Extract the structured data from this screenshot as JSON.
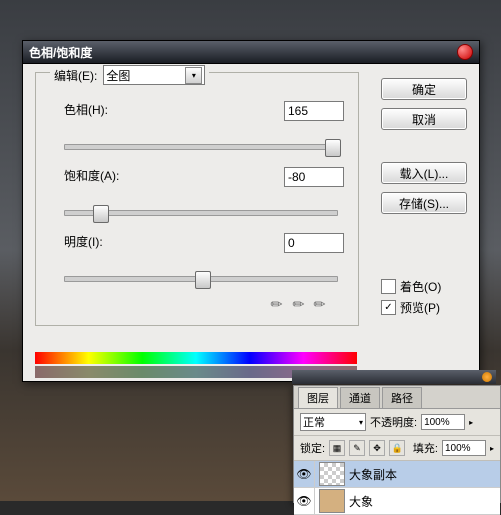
{
  "dialog": {
    "title": "色相/饱和度",
    "edit_label": "编辑(E):",
    "edit_value": "全图",
    "hue": {
      "label": "色相(H):",
      "value": "165",
      "pos": 260
    },
    "sat": {
      "label": "饱和度(A):",
      "value": "-80",
      "pos": 28
    },
    "lit": {
      "label": "明度(I):",
      "value": "0",
      "pos": 130
    }
  },
  "buttons": {
    "ok": "确定",
    "cancel": "取消",
    "load": "载入(L)...",
    "save": "存储(S)..."
  },
  "checkboxes": {
    "colorize": "着色(O)",
    "preview": "预览(P)"
  },
  "layers": {
    "tabs": {
      "layers": "图层",
      "channels": "通道",
      "paths": "路径"
    },
    "blend": "正常",
    "opacity_label": "不透明度:",
    "opacity_value": "100%",
    "lock_label": "锁定:",
    "fill_label": "填充:",
    "fill_value": "100%",
    "items": [
      {
        "name": "大象副本"
      },
      {
        "name": "大象"
      }
    ]
  }
}
